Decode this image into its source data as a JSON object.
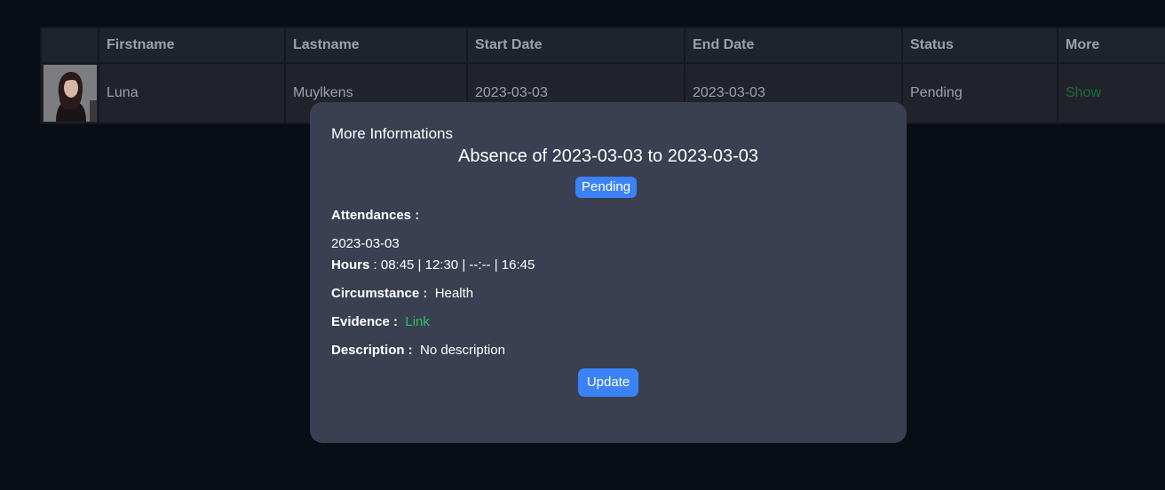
{
  "table": {
    "headers": {
      "photo": "",
      "firstname": "Firstname",
      "lastname": "Lastname",
      "start_date": "Start Date",
      "end_date": "End Date",
      "status": "Status",
      "more": "More"
    },
    "rows": [
      {
        "avatar": "person-avatar",
        "firstname": "Luna",
        "lastname": "Muylkens",
        "start_date": "2023-03-03",
        "end_date": "2023-03-03",
        "status": "Pending",
        "more": "Show"
      }
    ]
  },
  "modal": {
    "heading": "More Informations",
    "title": "Absence of 2023-03-03 to 2023-03-03",
    "status": "Pending",
    "attendances_label": "Attendances :",
    "attendance_date": "2023-03-03",
    "hours_label": "Hours",
    "hours_value": " : 08:45 | 12:30 | --:-- | 16:45",
    "circumstance_label": "Circumstance :",
    "circumstance_value": "Health",
    "evidence_label": "Evidence :",
    "evidence_value": "Link",
    "description_label": "Description :",
    "description_value": "No description",
    "update_label": "Update"
  },
  "colors": {
    "background": "#090d16",
    "modal": "#3a3f51",
    "accent_blue": "#3b82f6",
    "link_green": "#22c55e",
    "show_green": "#1c6b37"
  }
}
